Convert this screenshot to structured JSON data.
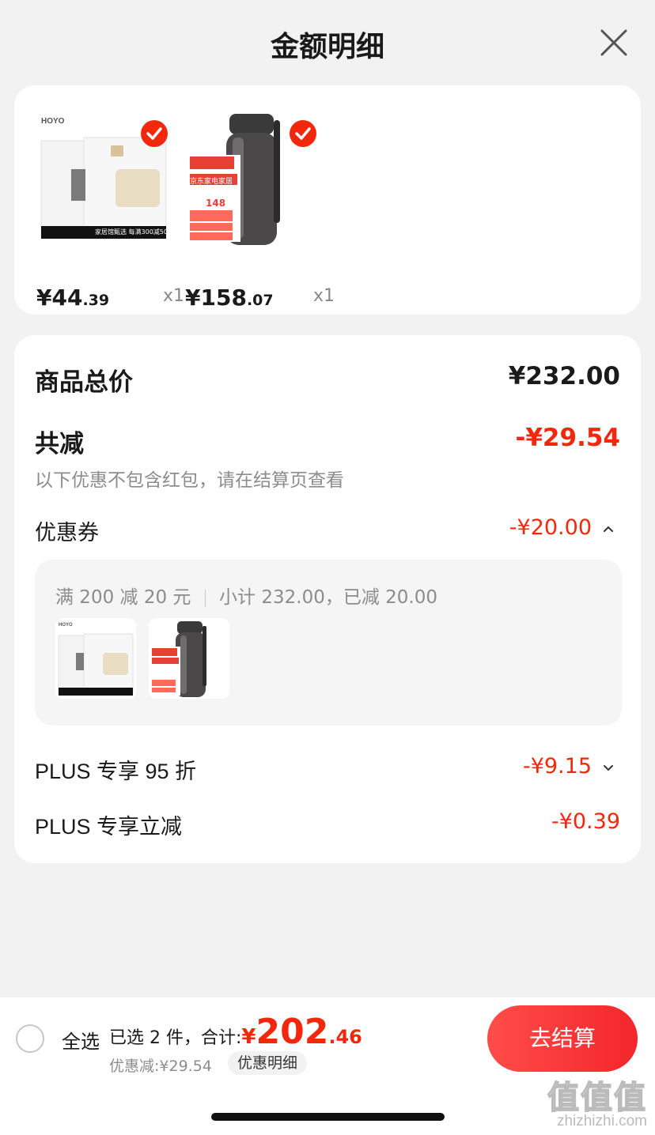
{
  "header": {
    "title": "金额明细",
    "close_icon": "close-icon"
  },
  "products": [
    {
      "brand": "HOYO",
      "banner": "家居馆甄选 每满300减50",
      "price_int": "¥44",
      "price_dec": ".39",
      "qty": "x1",
      "checked": true
    },
    {
      "badge_top": "京东家电家居",
      "badge_price": "148",
      "price_int": "¥158",
      "price_dec": ".07",
      "qty": "x1",
      "checked": true
    }
  ],
  "summary": {
    "total_label": "商品总价",
    "total_value": "¥232.00",
    "reduce_label": "共减",
    "reduce_value": "-¥29.54",
    "note": "以下优惠不包含红包，请在结算页查看",
    "coupon_label": "优惠券",
    "coupon_value": "-¥20.00",
    "coupon_detail": {
      "rule": "满 200 减 20 元",
      "subtotal": "小计 232.00，已减 20.00"
    },
    "plus_discount_label": "PLUS 专享 95 折",
    "plus_discount_value": "-¥9.15",
    "plus_reduce_label": "PLUS 专享立减",
    "plus_reduce_value": "-¥0.39"
  },
  "bottom": {
    "select_all": "全选",
    "selected_text": "已选 2 件，合计:",
    "total_symbol": "¥",
    "total_int": "202",
    "total_dec": ".46",
    "discount_line": "优惠减:¥29.54",
    "detail_chip": "优惠明细",
    "checkout": "去结算"
  },
  "watermark": {
    "main": "值值值",
    "url": "zhizhizhi.com"
  },
  "colors": {
    "accent": "#f2270c",
    "background": "#f2f2f2"
  }
}
